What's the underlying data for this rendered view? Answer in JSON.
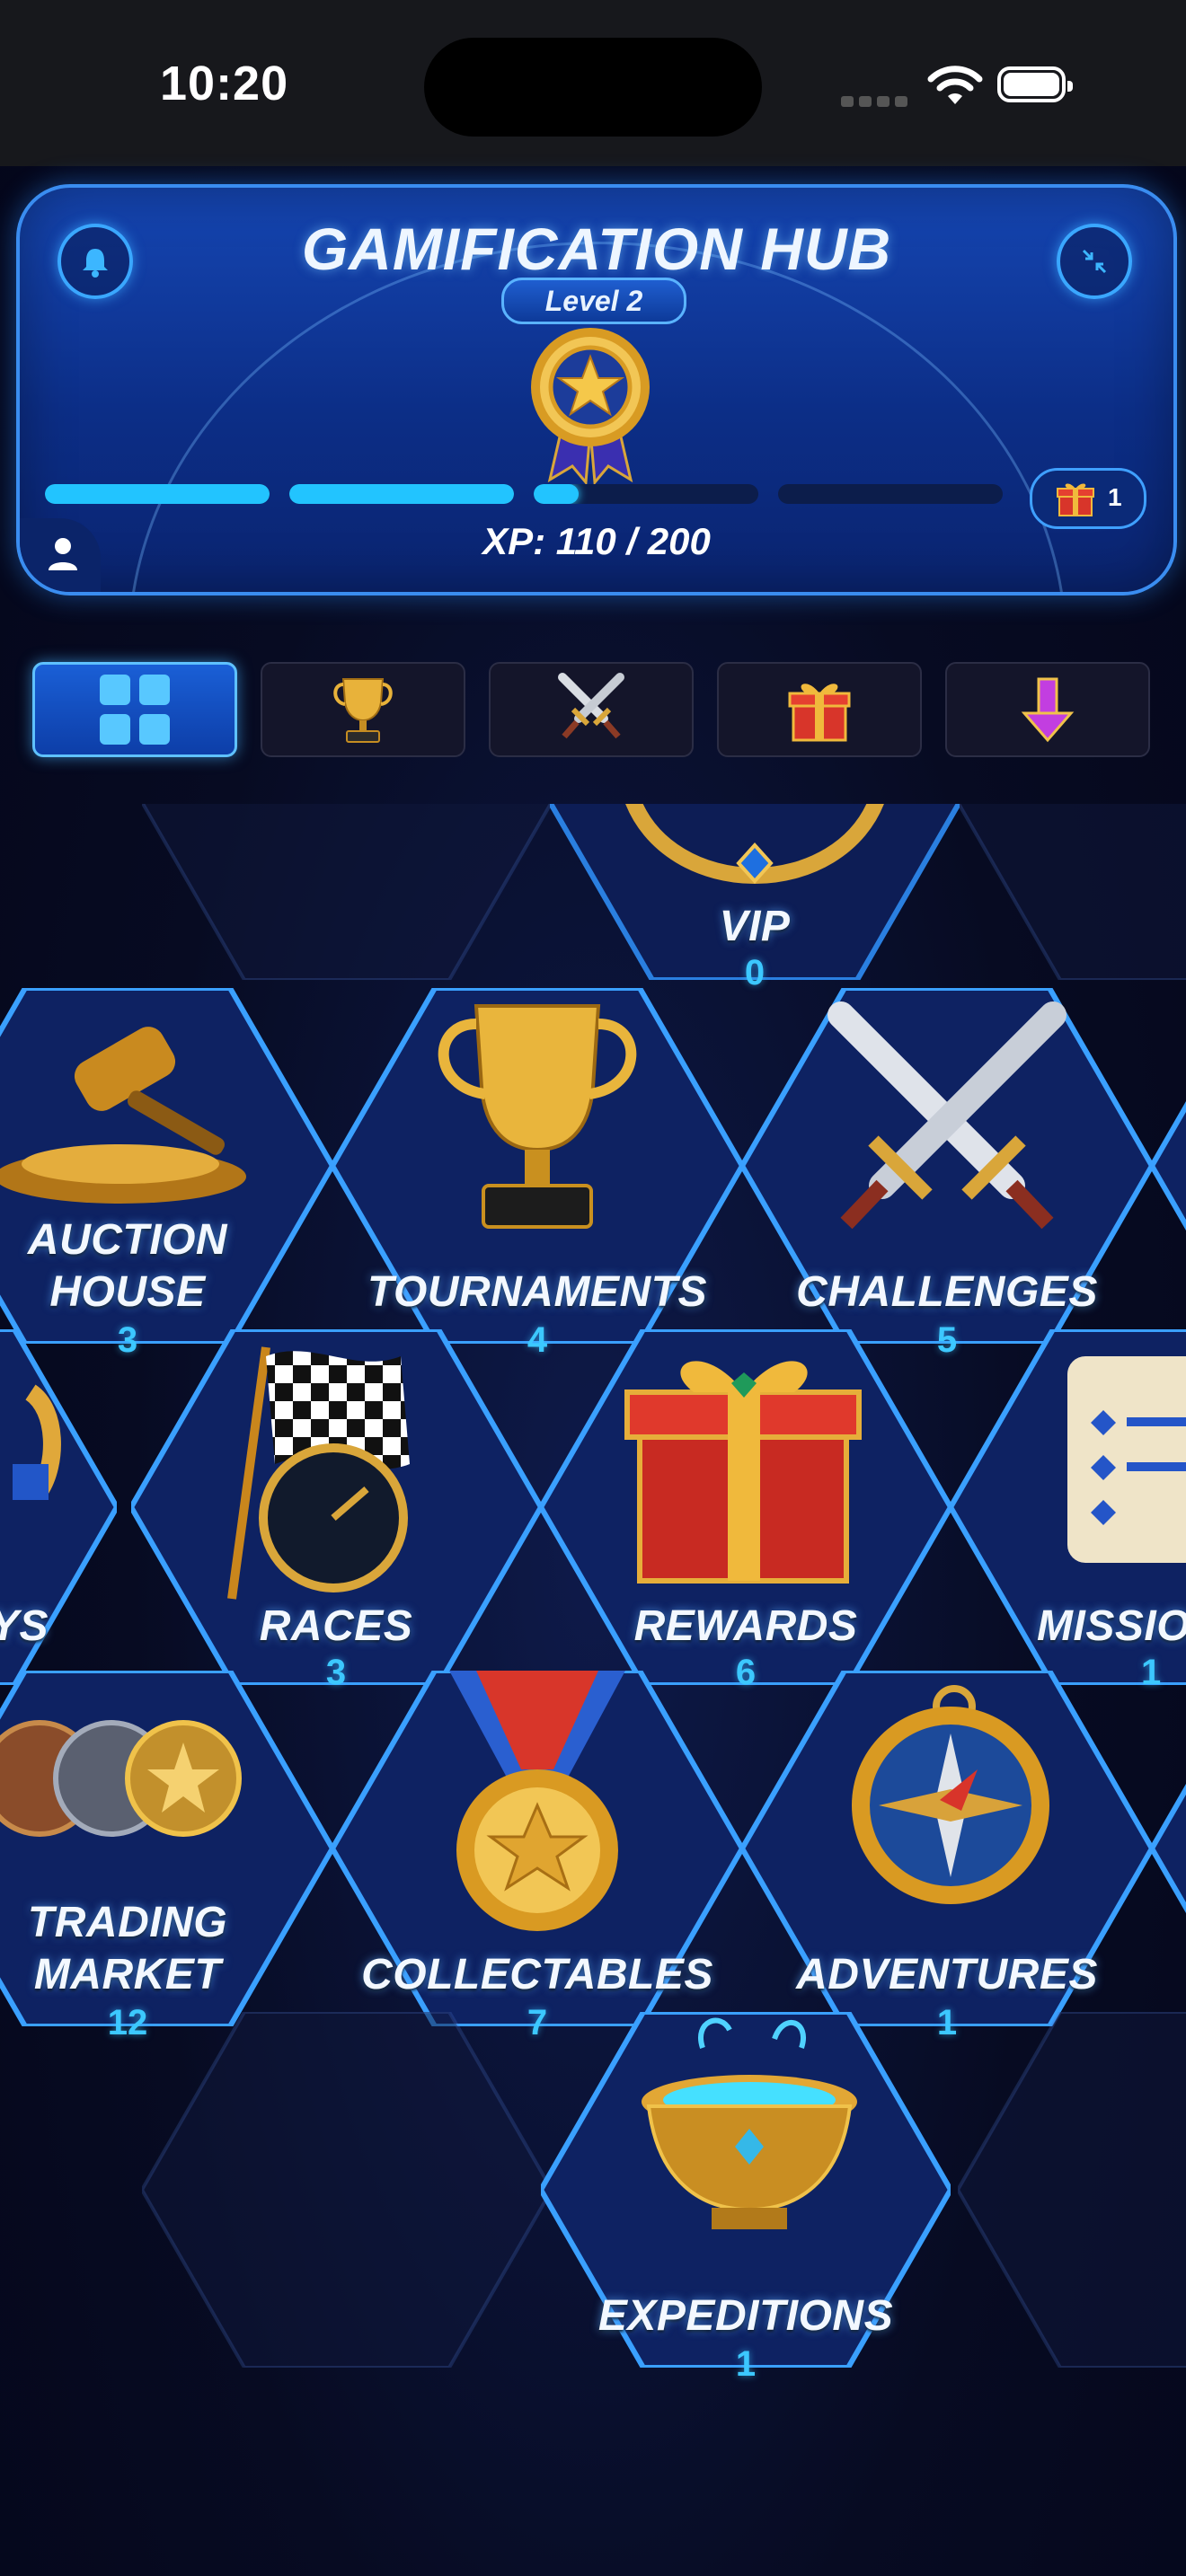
{
  "status": {
    "time": "10:20"
  },
  "hub": {
    "title": "GAMIFICATION HUB",
    "level": "Level 2",
    "xp_text": "XP: 110 / 200",
    "xp_segments": [
      1.0,
      1.0,
      0.2,
      0.0
    ],
    "gift_count": "1"
  },
  "tabs": [
    {
      "name": "grid",
      "icon": "grid-icon",
      "active": true
    },
    {
      "name": "tournaments",
      "icon": "trophy-icon",
      "active": false
    },
    {
      "name": "challenges",
      "icon": "crossed-swords-icon",
      "active": false
    },
    {
      "name": "rewards",
      "icon": "gift-icon",
      "active": false
    },
    {
      "name": "download",
      "icon": "down-arrow-icon",
      "active": false
    }
  ],
  "tiles": [
    {
      "key": "vip",
      "label": "VIP",
      "count": "0"
    },
    {
      "key": "auction",
      "label_lines": [
        "AUCTION",
        "HOUSE"
      ],
      "count": "3"
    },
    {
      "key": "tournaments",
      "label": "TOURNAMENTS",
      "count": "4"
    },
    {
      "key": "challenges",
      "label": "CHALLENGES",
      "count": "5"
    },
    {
      "key": "ys",
      "label": "YS",
      "count": ""
    },
    {
      "key": "races",
      "label": "RACES",
      "count": "3"
    },
    {
      "key": "rewards",
      "label": "REWARDS",
      "count": "6"
    },
    {
      "key": "missions",
      "label": "MISSIO",
      "count": "1"
    },
    {
      "key": "trading",
      "label_lines": [
        "TRADING",
        "MARKET"
      ],
      "count": "12"
    },
    {
      "key": "collectables",
      "label": "COLLECTABLES",
      "count": "7"
    },
    {
      "key": "adventures",
      "label": "ADVENTURES",
      "count": "1"
    },
    {
      "key": "expeditions",
      "label": "EXPEDITIONS",
      "count": "1"
    }
  ]
}
